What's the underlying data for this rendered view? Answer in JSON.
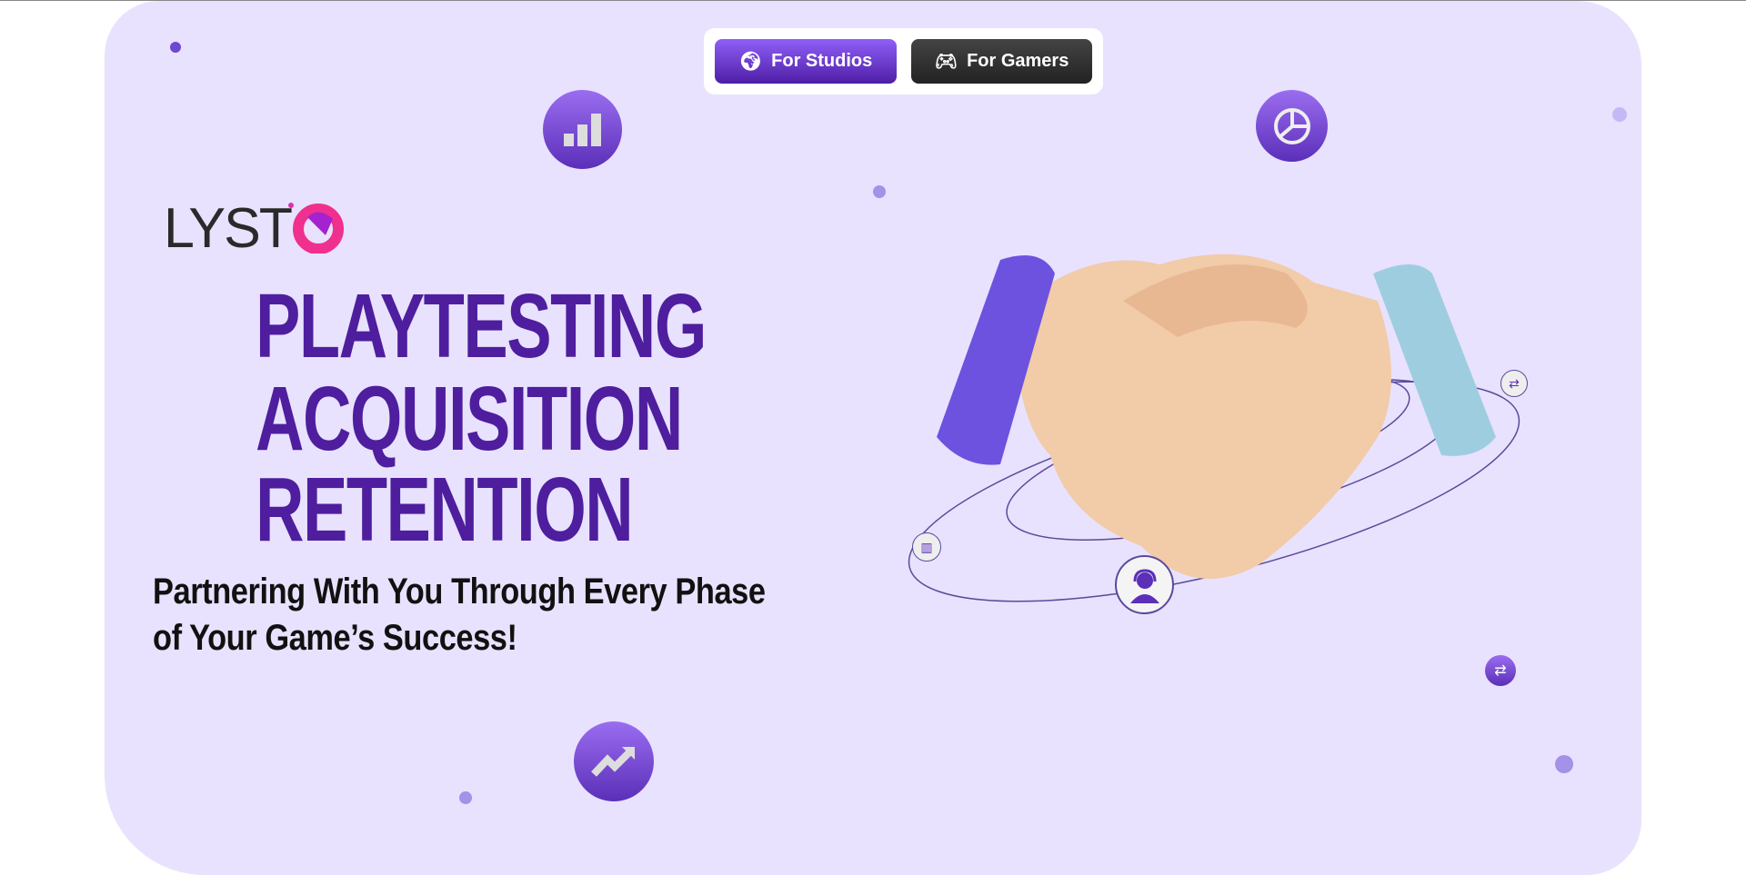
{
  "nav": {
    "studios_label": "For Studios",
    "gamers_label": "For Gamers"
  },
  "logo": {
    "text": "LYSTO"
  },
  "hero": {
    "line1": "PLAYTESTING",
    "line2": "ACQUISITION",
    "line3": "RETENTION",
    "subtitle_line1": "Partnering With You Through Every Phase",
    "subtitle_line2": "of Your Game’s Success!"
  },
  "colors": {
    "background": "#e8e2fe",
    "headline": "#4e1e9e",
    "studios_button": "#6a3ad8",
    "gamers_button": "#333333"
  }
}
